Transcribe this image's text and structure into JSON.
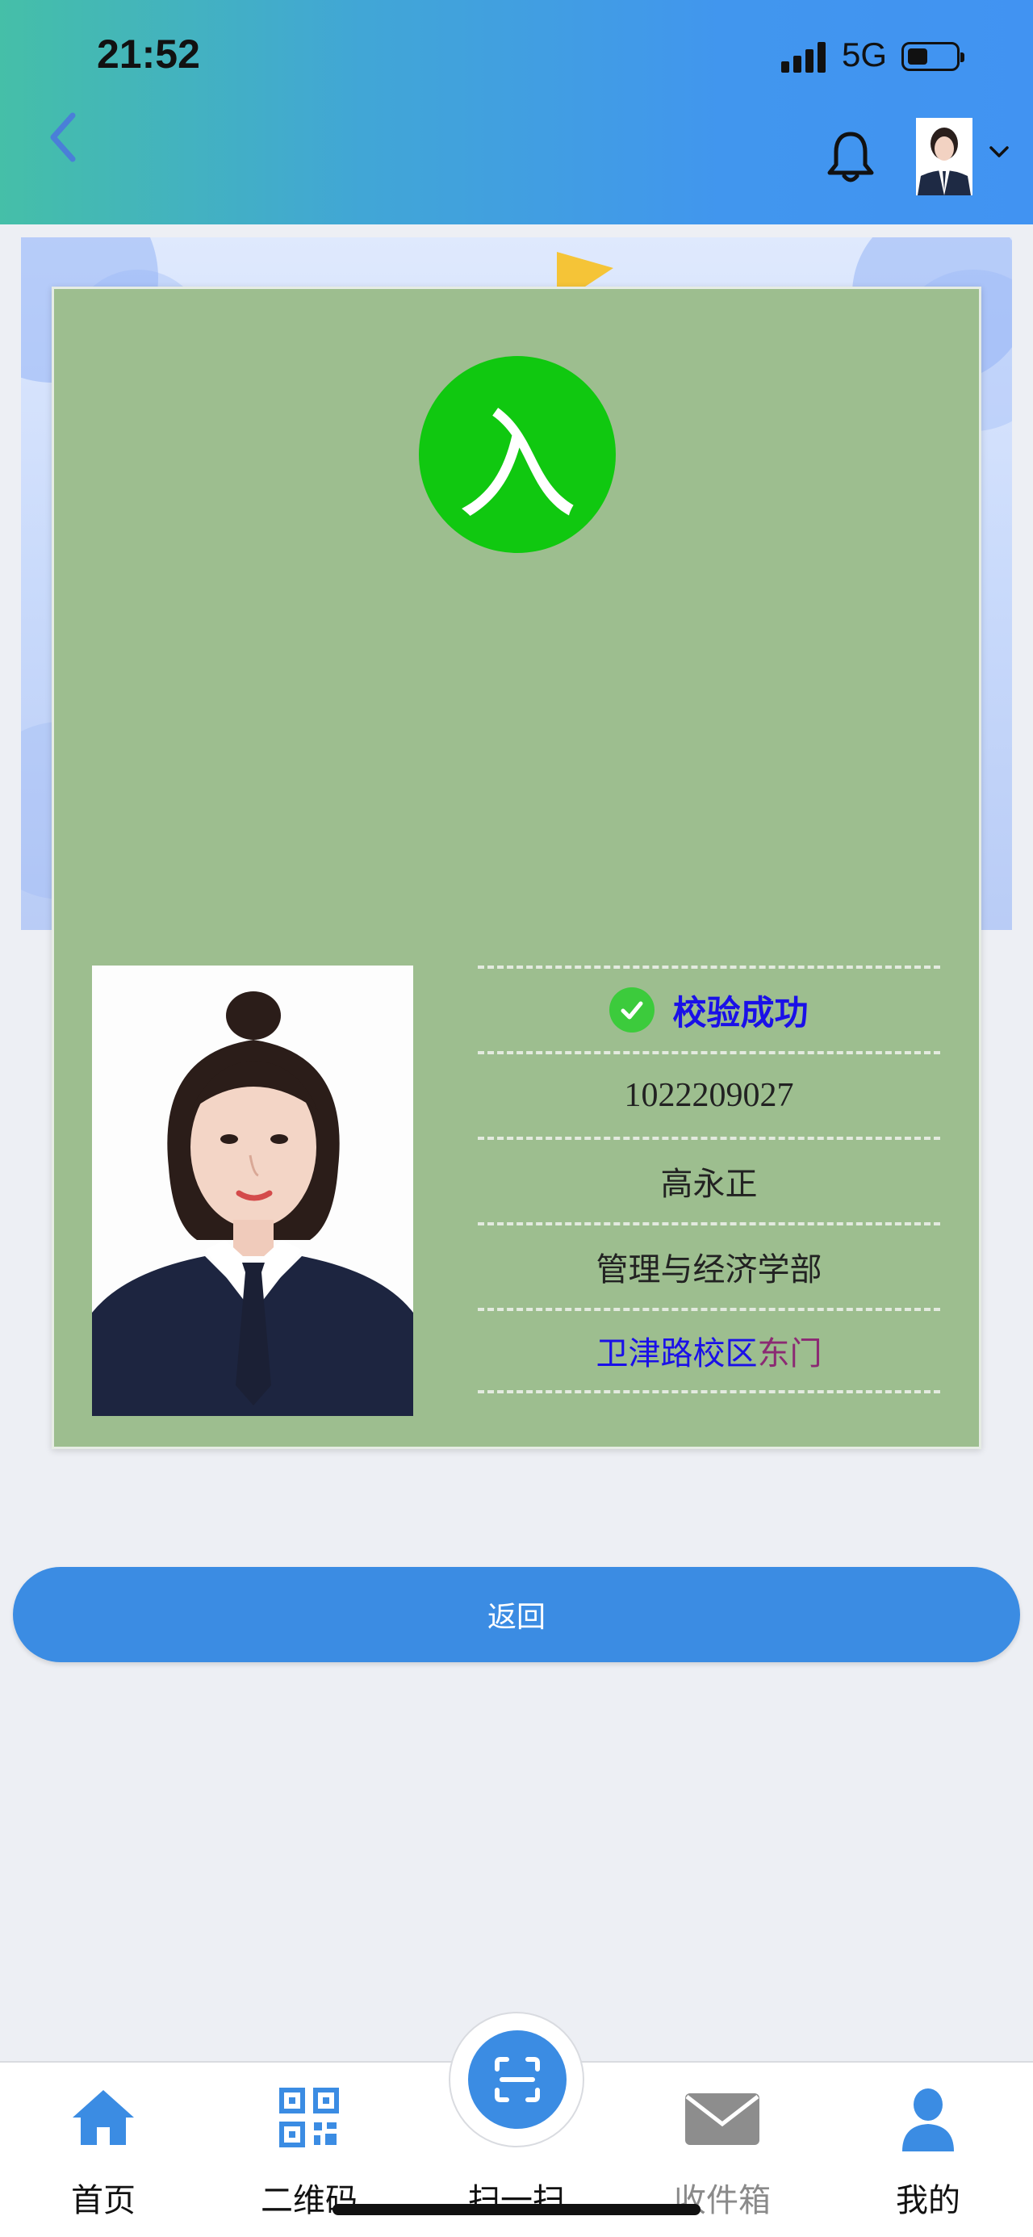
{
  "status_bar": {
    "time": "21:52",
    "network": "5G"
  },
  "header": {
    "back_icon": "chevron-left-icon",
    "bell_icon": "bell-icon",
    "dropdown_icon": "chevron-down-icon"
  },
  "card": {
    "entry_label": "入",
    "entry_color": "#10c810",
    "verify_text": "校验成功",
    "student_id": "1022209027",
    "name": "高永正",
    "department": "管理与经济学部",
    "campus": "卫津路校区",
    "gate": "东门"
  },
  "return_button": "返回",
  "tabs": [
    {
      "label": "首页",
      "icon": "home-icon"
    },
    {
      "label": "二维码",
      "icon": "qr-code-icon"
    },
    {
      "label": "扫一扫",
      "icon": "scan-icon"
    },
    {
      "label": "收件箱",
      "icon": "mail-icon"
    },
    {
      "label": "我的",
      "icon": "user-icon"
    }
  ],
  "colors": {
    "accent": "#3b8ce3",
    "card_bg": "#9dbe8f",
    "verify": "#1a10e8",
    "gate": "#8b2a73"
  }
}
